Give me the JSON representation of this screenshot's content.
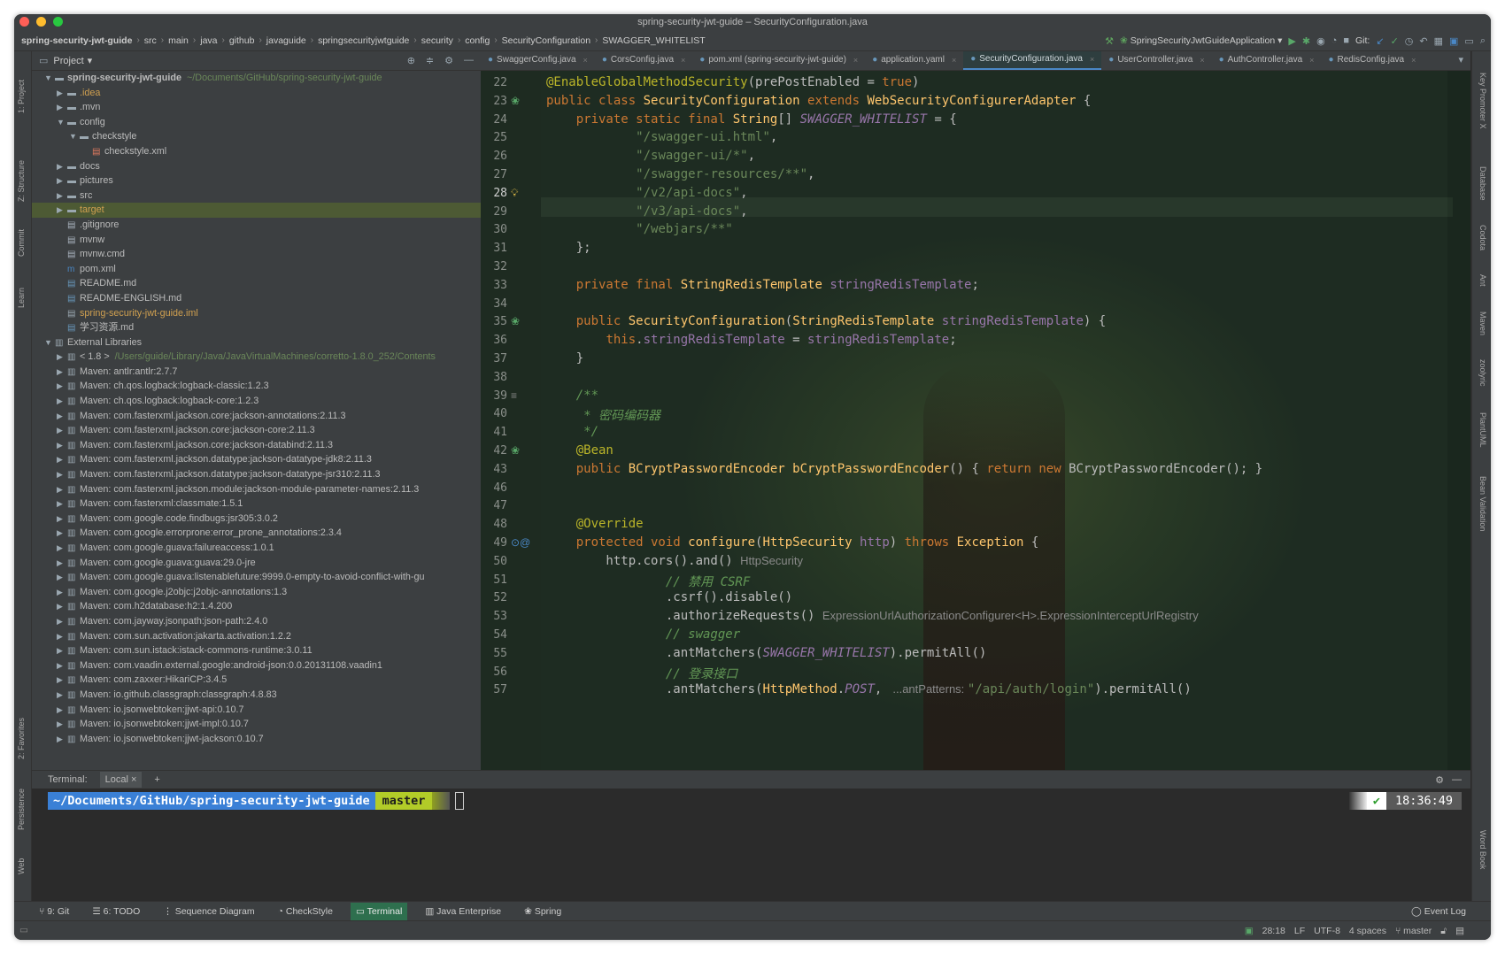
{
  "window": {
    "title": "spring-security-jwt-guide – SecurityConfiguration.java"
  },
  "breadcrumbs": [
    "spring-security-jwt-guide",
    "src",
    "main",
    "java",
    "github",
    "javaguide",
    "springsecurityjwtguide",
    "security",
    "config",
    "SecurityConfiguration",
    "SWAGGER_WHITELIST"
  ],
  "toolbar_right": {
    "run_config": "SpringSecurityJwtGuideApplication",
    "git_label": "Git:"
  },
  "project_panel": {
    "title": "Project"
  },
  "tree": [
    {
      "depth": 0,
      "arrow": "▼",
      "icon": "folder",
      "label": "spring-security-jwt-guide",
      "hint": "~/Documents/GitHub/spring-security-jwt-guide",
      "bold": true
    },
    {
      "depth": 1,
      "arrow": "▶",
      "icon": "folder",
      "label": ".idea",
      "color": "#d0a050"
    },
    {
      "depth": 1,
      "arrow": "▶",
      "icon": "folder",
      "label": ".mvn"
    },
    {
      "depth": 1,
      "arrow": "▼",
      "icon": "folder",
      "label": "config"
    },
    {
      "depth": 2,
      "arrow": "▼",
      "icon": "folder",
      "label": "checkstyle"
    },
    {
      "depth": 3,
      "arrow": "",
      "icon": "xml",
      "label": "checkstyle.xml"
    },
    {
      "depth": 1,
      "arrow": "▶",
      "icon": "folder",
      "label": "docs"
    },
    {
      "depth": 1,
      "arrow": "▶",
      "icon": "folder",
      "label": "pictures"
    },
    {
      "depth": 1,
      "arrow": "▶",
      "icon": "folder",
      "label": "src"
    },
    {
      "depth": 1,
      "arrow": "▶",
      "icon": "folder",
      "label": "target",
      "color": "#d0a050",
      "selected": true
    },
    {
      "depth": 1,
      "arrow": "",
      "icon": "file",
      "label": ".gitignore"
    },
    {
      "depth": 1,
      "arrow": "",
      "icon": "file",
      "label": "mvnw"
    },
    {
      "depth": 1,
      "arrow": "",
      "icon": "file",
      "label": "mvnw.cmd"
    },
    {
      "depth": 1,
      "arrow": "",
      "icon": "maven",
      "label": "pom.xml"
    },
    {
      "depth": 1,
      "arrow": "",
      "icon": "md",
      "label": "README.md"
    },
    {
      "depth": 1,
      "arrow": "",
      "icon": "md",
      "label": "README-ENGLISH.md"
    },
    {
      "depth": 1,
      "arrow": "",
      "icon": "iml",
      "label": "spring-security-jwt-guide.iml",
      "color": "#d0a050"
    },
    {
      "depth": 1,
      "arrow": "",
      "icon": "md",
      "label": "学习资源.md"
    },
    {
      "depth": 0,
      "arrow": "▼",
      "icon": "lib",
      "label": "External Libraries"
    },
    {
      "depth": 1,
      "arrow": "▶",
      "icon": "lib",
      "label": "< 1.8 >",
      "hint": "/Users/guide/Library/Java/JavaVirtualMachines/corretto-1.8.0_252/Contents"
    },
    {
      "depth": 1,
      "arrow": "▶",
      "icon": "lib",
      "label": "Maven: antlr:antlr:2.7.7"
    },
    {
      "depth": 1,
      "arrow": "▶",
      "icon": "lib",
      "label": "Maven: ch.qos.logback:logback-classic:1.2.3"
    },
    {
      "depth": 1,
      "arrow": "▶",
      "icon": "lib",
      "label": "Maven: ch.qos.logback:logback-core:1.2.3"
    },
    {
      "depth": 1,
      "arrow": "▶",
      "icon": "lib",
      "label": "Maven: com.fasterxml.jackson.core:jackson-annotations:2.11.3"
    },
    {
      "depth": 1,
      "arrow": "▶",
      "icon": "lib",
      "label": "Maven: com.fasterxml.jackson.core:jackson-core:2.11.3"
    },
    {
      "depth": 1,
      "arrow": "▶",
      "icon": "lib",
      "label": "Maven: com.fasterxml.jackson.core:jackson-databind:2.11.3"
    },
    {
      "depth": 1,
      "arrow": "▶",
      "icon": "lib",
      "label": "Maven: com.fasterxml.jackson.datatype:jackson-datatype-jdk8:2.11.3"
    },
    {
      "depth": 1,
      "arrow": "▶",
      "icon": "lib",
      "label": "Maven: com.fasterxml.jackson.datatype:jackson-datatype-jsr310:2.11.3"
    },
    {
      "depth": 1,
      "arrow": "▶",
      "icon": "lib",
      "label": "Maven: com.fasterxml.jackson.module:jackson-module-parameter-names:2.11.3"
    },
    {
      "depth": 1,
      "arrow": "▶",
      "icon": "lib",
      "label": "Maven: com.fasterxml:classmate:1.5.1"
    },
    {
      "depth": 1,
      "arrow": "▶",
      "icon": "lib",
      "label": "Maven: com.google.code.findbugs:jsr305:3.0.2"
    },
    {
      "depth": 1,
      "arrow": "▶",
      "icon": "lib",
      "label": "Maven: com.google.errorprone:error_prone_annotations:2.3.4"
    },
    {
      "depth": 1,
      "arrow": "▶",
      "icon": "lib",
      "label": "Maven: com.google.guava:failureaccess:1.0.1"
    },
    {
      "depth": 1,
      "arrow": "▶",
      "icon": "lib",
      "label": "Maven: com.google.guava:guava:29.0-jre"
    },
    {
      "depth": 1,
      "arrow": "▶",
      "icon": "lib",
      "label": "Maven: com.google.guava:listenablefuture:9999.0-empty-to-avoid-conflict-with-gu"
    },
    {
      "depth": 1,
      "arrow": "▶",
      "icon": "lib",
      "label": "Maven: com.google.j2objc:j2objc-annotations:1.3"
    },
    {
      "depth": 1,
      "arrow": "▶",
      "icon": "lib",
      "label": "Maven: com.h2database:h2:1.4.200"
    },
    {
      "depth": 1,
      "arrow": "▶",
      "icon": "lib",
      "label": "Maven: com.jayway.jsonpath:json-path:2.4.0"
    },
    {
      "depth": 1,
      "arrow": "▶",
      "icon": "lib",
      "label": "Maven: com.sun.activation:jakarta.activation:1.2.2"
    },
    {
      "depth": 1,
      "arrow": "▶",
      "icon": "lib",
      "label": "Maven: com.sun.istack:istack-commons-runtime:3.0.11"
    },
    {
      "depth": 1,
      "arrow": "▶",
      "icon": "lib",
      "label": "Maven: com.vaadin.external.google:android-json:0.0.20131108.vaadin1"
    },
    {
      "depth": 1,
      "arrow": "▶",
      "icon": "lib",
      "label": "Maven: com.zaxxer:HikariCP:3.4.5"
    },
    {
      "depth": 1,
      "arrow": "▶",
      "icon": "lib",
      "label": "Maven: io.github.classgraph:classgraph:4.8.83"
    },
    {
      "depth": 1,
      "arrow": "▶",
      "icon": "lib",
      "label": "Maven: io.jsonwebtoken:jjwt-api:0.10.7"
    },
    {
      "depth": 1,
      "arrow": "▶",
      "icon": "lib",
      "label": "Maven: io.jsonwebtoken:jjwt-impl:0.10.7"
    },
    {
      "depth": 1,
      "arrow": "▶",
      "icon": "lib",
      "label": "Maven: io.jsonwebtoken:jjwt-jackson:0.10.7"
    }
  ],
  "tabs": [
    {
      "label": "SwaggerConfig.java",
      "active": false
    },
    {
      "label": "CorsConfig.java",
      "active": false
    },
    {
      "label": "pom.xml (spring-security-jwt-guide)",
      "active": false
    },
    {
      "label": "application.yaml",
      "active": false
    },
    {
      "label": "SecurityConfiguration.java",
      "active": true
    },
    {
      "label": "UserController.java",
      "active": false
    },
    {
      "label": "AuthController.java",
      "active": false
    },
    {
      "label": "RedisConfig.java",
      "active": false
    }
  ],
  "editor": {
    "current_line": "28",
    "lines": [
      {
        "n": "22",
        "html": "<span class='an'>@EnableGlobalMethodSecurity</span>(prePostEnabled = <span class='kw'>true</span>)"
      },
      {
        "n": "23",
        "gm": "bean",
        "html": "<span class='kw'>public class </span><span class='cl'>SecurityConfiguration </span><span class='kw'>extends </span><span class='cl'>WebSecurityConfigurerAdapter</span> {"
      },
      {
        "n": "24",
        "html": "    <span class='kw'>private static final </span><span class='cl'>String</span>[] <span class='fi it'>SWAGGER_WHITELIST</span> = {"
      },
      {
        "n": "25",
        "html": "            <span class='st'>\"/swagger-ui.html\"</span>,"
      },
      {
        "n": "26",
        "html": "            <span class='st'>\"/swagger-ui/*\"</span>,"
      },
      {
        "n": "27",
        "html": "            <span class='st'>\"/swagger-resources/**\"</span>,"
      },
      {
        "n": "28",
        "gm": "bulb",
        "html": "            <span class='st'>\"/v2/api-docs\"</span>,"
      },
      {
        "n": "29",
        "html": "            <span class='st'>\"/v3/api-docs\"</span>,"
      },
      {
        "n": "30",
        "html": "            <span class='st'>\"/webjars/**\"</span>"
      },
      {
        "n": "31",
        "html": "    };"
      },
      {
        "n": "32",
        "html": ""
      },
      {
        "n": "33",
        "html": "    <span class='kw'>private final </span><span class='cl'>StringRedisTemplate </span><span class='fi'>stringRedisTemplate</span>;"
      },
      {
        "n": "34",
        "html": ""
      },
      {
        "n": "35",
        "gm": "bean",
        "html": "    <span class='kw'>public </span><span class='cl'>SecurityConfiguration</span>(<span class='cl'>StringRedisTemplate </span><span class='fi'>stringRedisTemplate</span>) {"
      },
      {
        "n": "36",
        "html": "        <span class='kw'>this</span>.<span class='fi'>stringRedisTemplate</span> = <span class='fi'>stringRedisTemplate</span>;"
      },
      {
        "n": "37",
        "html": "    }"
      },
      {
        "n": "38",
        "html": ""
      },
      {
        "n": "39",
        "gm": "doc",
        "html": "    <span class='cm it'>/**</span>"
      },
      {
        "n": "40",
        "html": "<span class='cm it'>     * 密码编码器</span>"
      },
      {
        "n": "41",
        "html": "<span class='cm it'>     */</span>"
      },
      {
        "n": "42",
        "gm": "bean",
        "html": "    <span class='an'>@Bean</span>"
      },
      {
        "n": "43",
        "html": "    <span class='kw'>public </span><span class='cl'>BCryptPasswordEncoder </span><span class='cl'>bCryptPasswordEncoder</span>() { <span class='kw'>return new </span>BCryptPasswordEncoder(); }"
      },
      {
        "n": "46",
        "html": ""
      },
      {
        "n": "47",
        "html": ""
      },
      {
        "n": "48",
        "html": "    <span class='an'>@Override</span>"
      },
      {
        "n": "49",
        "gm": "override",
        "html": "    <span class='kw'>protected void </span><span class='cl'>configure</span>(<span class='cl'>HttpSecurity </span><span class='fi'>http</span>) <span class='kw'>throws </span><span class='cl'>Exception</span> {"
      },
      {
        "n": "50",
        "html": "        http.cors().and() <span class='hn'>HttpSecurity</span>"
      },
      {
        "n": "51",
        "html": "                <span class='cm it'>// 禁用 CSRF</span>"
      },
      {
        "n": "52",
        "html": "                .csrf().disable()"
      },
      {
        "n": "53",
        "html": "                .authorizeRequests() <span class='hn'>ExpressionUrlAuthorizationConfigurer&lt;H&gt;.ExpressionInterceptUrlRegistry</span>"
      },
      {
        "n": "54",
        "html": "                <span class='cm it'>// swagger</span>"
      },
      {
        "n": "55",
        "html": "                .antMatchers(<span class='fi it'>SWAGGER_WHITELIST</span>).permitAll()"
      },
      {
        "n": "56",
        "html": "                <span class='cm it'>// 登录接口</span>"
      },
      {
        "n": "57",
        "html": "                .antMatchers(<span class='cl'>HttpMethod</span>.<span class='fi it'>POST</span>, <span class='hn'> ...antPatterns: </span><span class='st'>\"/api/auth/login\"</span>).permitAll()"
      }
    ]
  },
  "terminal": {
    "label": "Terminal:",
    "tab": "Local",
    "path": "~/Documents/GitHub/spring-security-jwt-guide",
    "branch": "master",
    "time": "18:36:49"
  },
  "tool_windows": [
    {
      "label": "9: Git",
      "active": false
    },
    {
      "label": "6: TODO",
      "active": false
    },
    {
      "label": "Sequence Diagram",
      "active": false
    },
    {
      "label": "CheckStyle",
      "active": false
    },
    {
      "label": "Terminal",
      "active": true
    },
    {
      "label": "Java Enterprise",
      "active": false
    },
    {
      "label": "Spring",
      "active": false
    }
  ],
  "event_log": "Event Log",
  "status": {
    "position": "28:18",
    "line_sep": "LF",
    "encoding": "UTF-8",
    "indent": "4 spaces",
    "branch": "master"
  },
  "left_strip": [
    "1: Project",
    "Z: Structure",
    "Commit",
    "Learn",
    "2: Favorites",
    "Persistence",
    "Web"
  ],
  "right_strip": [
    "Key Promoter X",
    "Database",
    "Codota",
    "Ant",
    "Maven",
    "zoolyric",
    "PlantUML",
    "Bean Validation",
    "Word Book"
  ],
  "colors": {
    "accent": "#4a88c7",
    "selection": "#4d5a34",
    "terminal_path_bg": "#3a80d6",
    "terminal_branch_bg": "#b2cc28"
  }
}
